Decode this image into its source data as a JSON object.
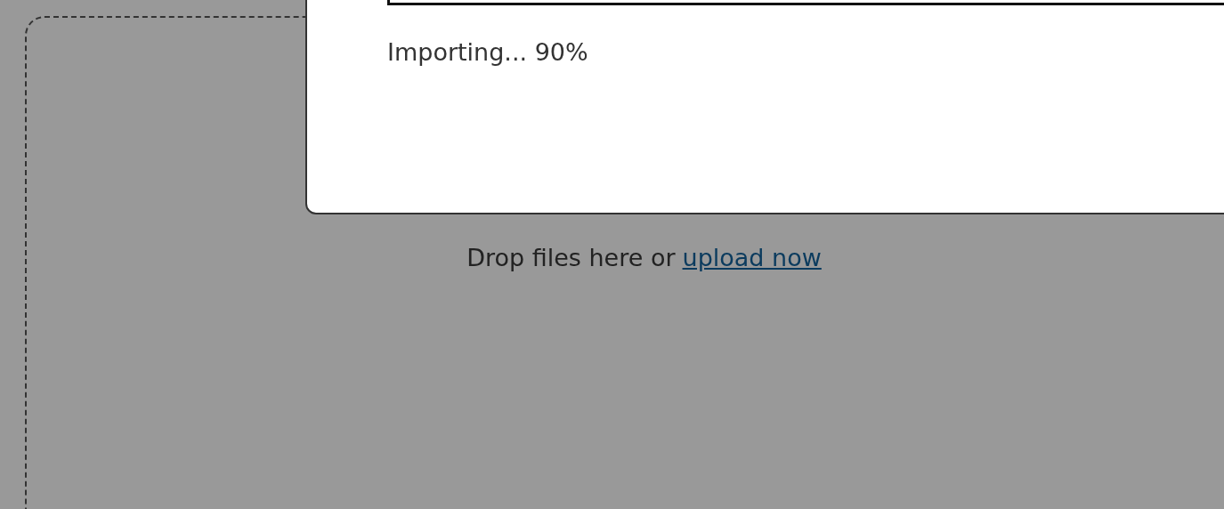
{
  "import_dialog": {
    "status": "Importing... 90%"
  },
  "drop_zone": {
    "prompt": "Drop files here or",
    "link": "upload now"
  }
}
